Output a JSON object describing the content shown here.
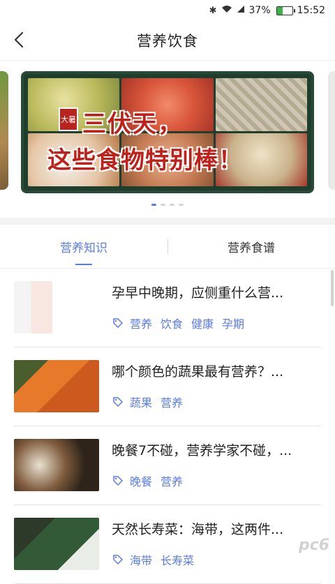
{
  "status_bar": {
    "battery": "37%",
    "time": "15:52",
    "battery_level": 0.37
  },
  "header": {
    "title": "营养饮食"
  },
  "banner": {
    "tag": "大暑",
    "line1": "三伏天，",
    "line2": "这些食物特别棒！",
    "page_count": 4,
    "active_page": 1
  },
  "tabs": [
    {
      "label": "营养知识",
      "active": true
    },
    {
      "label": "营养食谱",
      "active": false
    }
  ],
  "articles": [
    {
      "title": "孕早中晚期，应侧重什么营...",
      "tags": [
        "营养",
        "饮食",
        "健康",
        "孕期"
      ]
    },
    {
      "title": "哪个颜色的蔬果最有营养？...",
      "tags": [
        "蔬果",
        "营养"
      ]
    },
    {
      "title": "晚餐7不碰，营养学家不碰，...",
      "tags": [
        "晚餐",
        "营养"
      ]
    },
    {
      "title": "天然长寿菜：海带，这两件...",
      "tags": [
        "海带",
        "长寿菜"
      ]
    }
  ],
  "watermark": "pc6",
  "colors": {
    "accent": "#5b7be6",
    "banner_red": "#c0201a"
  }
}
